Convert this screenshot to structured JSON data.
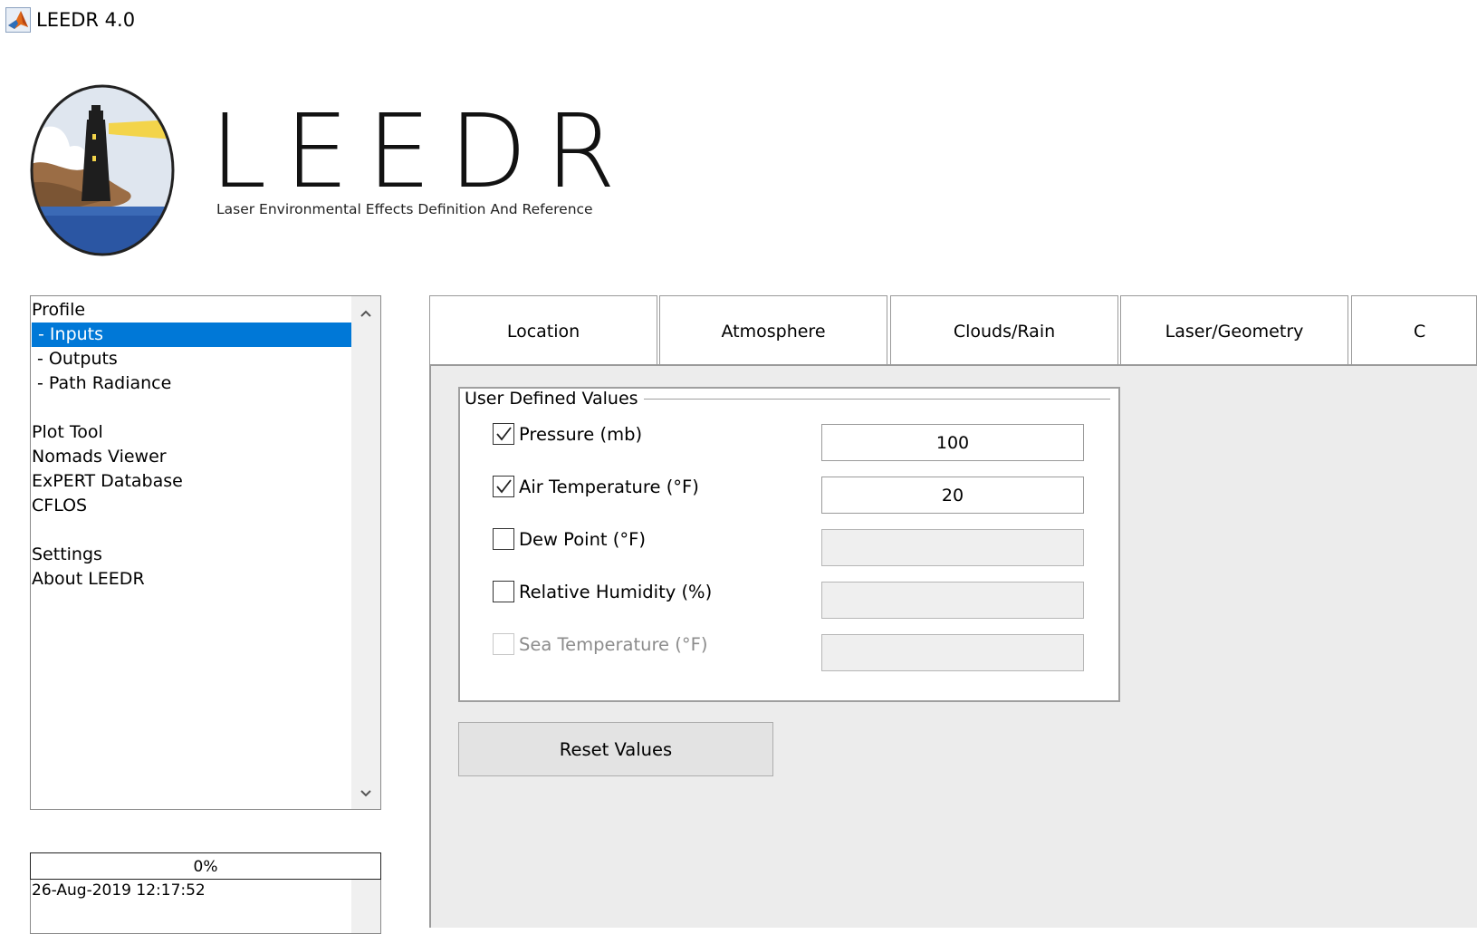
{
  "window": {
    "title": "LEEDR 4.0",
    "icon": "matlab-icon"
  },
  "logo": {
    "icon": "lighthouse-logo",
    "wordmark": "LEEDR",
    "subtitle": "Laser Environmental Effects Definition And Reference"
  },
  "nav": {
    "items": [
      {
        "label": "Profile",
        "selected": false
      },
      {
        "label": " - Inputs",
        "selected": true
      },
      {
        "label": " - Outputs",
        "selected": false
      },
      {
        "label": " - Path Radiance",
        "selected": false
      },
      {
        "label": "",
        "selected": false
      },
      {
        "label": "Plot Tool",
        "selected": false
      },
      {
        "label": "Nomads Viewer",
        "selected": false
      },
      {
        "label": "ExPERT Database",
        "selected": false
      },
      {
        "label": "CFLOS",
        "selected": false
      },
      {
        "label": "",
        "selected": false
      },
      {
        "label": "Settings",
        "selected": false
      },
      {
        "label": "About LEEDR",
        "selected": false
      }
    ],
    "scroll_up_icon": "chevron-up-icon",
    "scroll_down_icon": "chevron-down-icon"
  },
  "progress": {
    "text": "0%",
    "value": 0
  },
  "log": {
    "text": "26-Aug-2019 12:17:52"
  },
  "tabs": [
    {
      "label": "Location"
    },
    {
      "label": "Atmosphere"
    },
    {
      "label": "Clouds/Rain"
    },
    {
      "label": "Laser/Geometry"
    },
    {
      "label": "C"
    }
  ],
  "panel": {
    "group_title": "User Defined Values",
    "rows": [
      {
        "label": "Pressure (mb)",
        "checked": true,
        "enabled": true,
        "value": "100"
      },
      {
        "label": "Air Temperature (°F)",
        "checked": true,
        "enabled": true,
        "value": "20"
      },
      {
        "label": "Dew Point (°F)",
        "checked": false,
        "enabled": true,
        "value": ""
      },
      {
        "label": "Relative Humidity (%)",
        "checked": false,
        "enabled": true,
        "value": ""
      },
      {
        "label": "Sea Temperature (°F)",
        "checked": false,
        "enabled": false,
        "value": ""
      }
    ],
    "reset_label": "Reset Values"
  },
  "colors": {
    "selection": "#0078d7",
    "panel_bg": "#ececec",
    "button_bg": "#e3e3e3"
  }
}
